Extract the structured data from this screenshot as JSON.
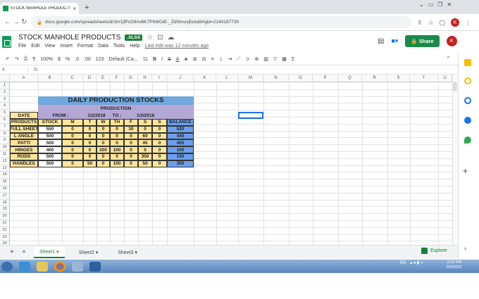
{
  "browser": {
    "tab_title": "STOCK MANHOLE PRODUCTS.xls",
    "url": "docs.google.com/spreadsheets/d/1hr1jfPcGfmv6K7PlIWGIE-_ZdNmusjfo/edit#gid=2140187739",
    "avatar": "K"
  },
  "doc": {
    "title": "STOCK MANHOLE PRODUCTS",
    "badge": ".XLSX",
    "menus": [
      "File",
      "Edit",
      "View",
      "Insert",
      "Format",
      "Data",
      "Tools",
      "Help"
    ],
    "last_edit": "Last edit was 12 minutes ago",
    "share": "Share"
  },
  "toolbar": {
    "zoom": "100%",
    "currency": "$",
    "percent": "%",
    "dec1": ".0",
    "dec2": ".00",
    "fmt": "123",
    "font": "Default (Ca...",
    "size": "11"
  },
  "formula": {
    "cellref": "4",
    "fx": "fx"
  },
  "columns": [
    "A",
    "B",
    "C",
    "D",
    "E",
    "F",
    "G",
    "H",
    "I",
    "J",
    "K",
    "L",
    "M",
    "N",
    "O",
    "P",
    "Q",
    "R",
    "S",
    "T",
    "U"
  ],
  "rows": [
    "1",
    "2",
    "3",
    "4",
    "5",
    "6",
    "7",
    "8",
    "9",
    "10",
    "11",
    "12",
    "13",
    "14",
    "15",
    "16",
    "17",
    "18",
    "19",
    "20",
    "21",
    "22",
    "23",
    "24"
  ],
  "sheet": {
    "title": "DAILY PRODUCTION STOCKS",
    "subtitle": "PRODUCTION",
    "date_label": "DATE",
    "from_label": "FROM :",
    "from_date": "1/2/2018",
    "to_label": "TO :",
    "to_date": "1/3/2018",
    "headers": [
      "PRODUCTS",
      "STOCK",
      "M",
      "T",
      "W",
      "TH",
      "F",
      "S",
      "S",
      "BALANCE"
    ],
    "data": [
      [
        "FULL SHEET",
        "550",
        "0",
        "0",
        "0",
        "0",
        "30",
        "0",
        "0",
        "520"
      ],
      [
        "L ANGLE",
        "500",
        "0",
        "0",
        "0",
        "0",
        "0",
        "60",
        "0",
        "440"
      ],
      [
        "PATTI",
        "500",
        "0",
        "0",
        "0",
        "0",
        "0",
        "45",
        "0",
        "455"
      ],
      [
        "HINGES",
        "400",
        "0",
        "0",
        "200",
        "100",
        "0",
        "0",
        "0",
        "100"
      ],
      [
        "RODS",
        "500",
        "0",
        "0",
        "0",
        "0",
        "0",
        "350",
        "0",
        "150"
      ],
      [
        "HANDLES",
        "500",
        "0",
        "50",
        "0",
        "100",
        "0",
        "50",
        "0",
        "300"
      ]
    ]
  },
  "sheets": [
    "Sheet1",
    "Sheet2",
    "Sheet3"
  ],
  "explore": "Explore",
  "taskbar": {
    "lang": "EN",
    "time": "3:15 PM",
    "date": "8/9/2022"
  },
  "colors": {
    "accent": "#188038",
    "title_bg": "#6fa8dc",
    "sub_bg": "#b4a7d6",
    "yellow": "#ffe599",
    "blue": "#6d9eeb"
  }
}
